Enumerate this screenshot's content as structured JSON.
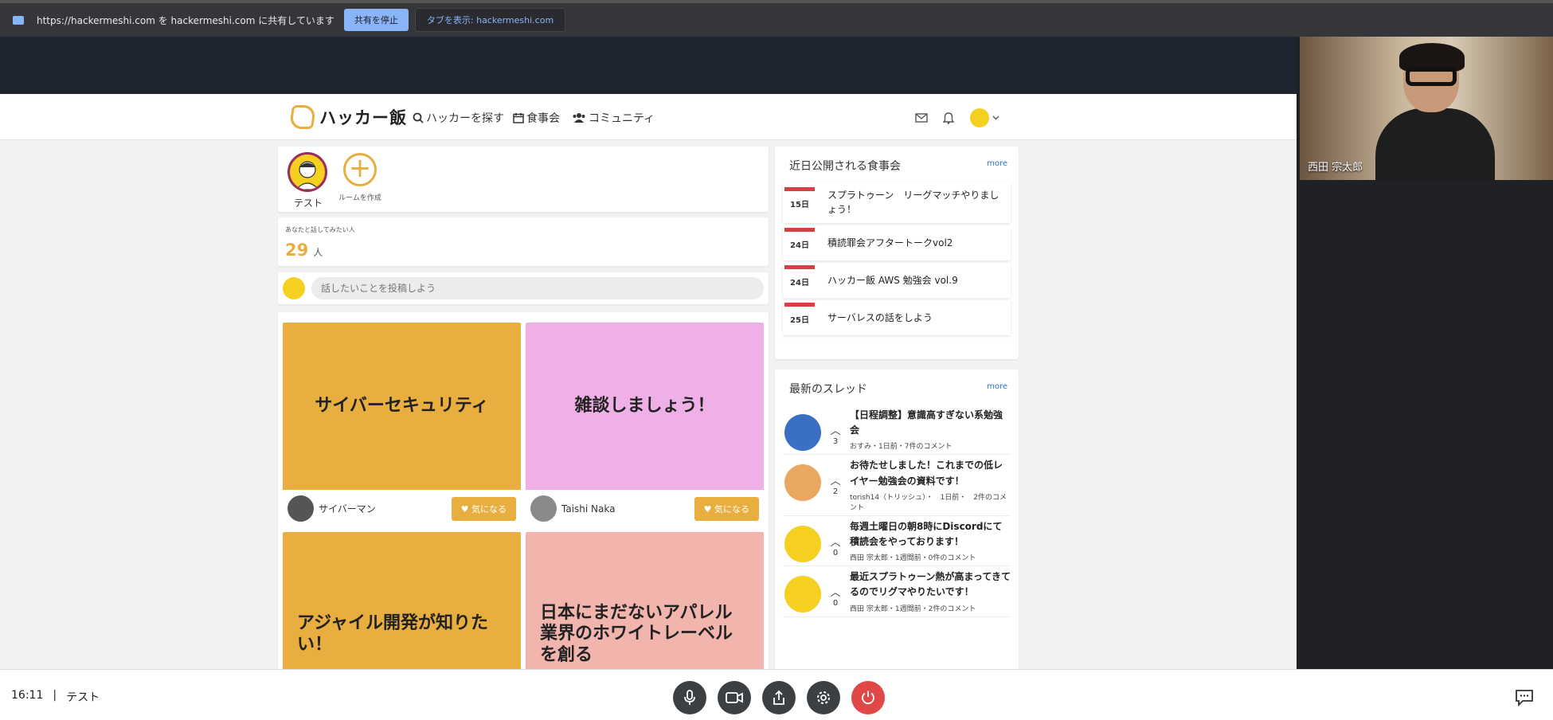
{
  "share_bar": {
    "message": "https://hackermeshi.com を hackermeshi.com に共有しています",
    "stop_label": "共有を停止",
    "show_tab_label": "タブを表示: hackermeshi.com"
  },
  "site": {
    "logo_text": "ハッカー飯",
    "nav": [
      "ハッカーを探す",
      "食事会",
      "コミュニティ"
    ]
  },
  "stories": {
    "user_name": "テスト",
    "create_label": "ルームを作成"
  },
  "want_to_talk": {
    "label": "あなたと話してみたい人",
    "count": "29",
    "unit": "人"
  },
  "post": {
    "placeholder": "話したいことを投稿しよう"
  },
  "rooms": [
    {
      "title": "サイバーセキュリティ",
      "owner": "サイバーマン",
      "like_label": "気になる",
      "color": "#e8ae3f"
    },
    {
      "title": "雑談しましょう！",
      "owner": "Taishi Naka",
      "like_label": "気になる",
      "color": "#eeb0e6"
    },
    {
      "title": "アジャイル開発が知りたい！",
      "color": "#e8ae3f"
    },
    {
      "title": "日本にまだないアパレル業界のホワイトレーベルを創る",
      "color": "#f1b5ad"
    }
  ],
  "events": {
    "title": "近日公開される食事会",
    "more": "more",
    "items": [
      {
        "date": "15日",
        "title": "スプラトゥーン　リーグマッチやりましょう！"
      },
      {
        "date": "24日",
        "title": "積読罪会アフタートークvol2"
      },
      {
        "date": "24日",
        "title": "ハッカー飯 AWS 勉強会 vol.9"
      },
      {
        "date": "25日",
        "title": "サーバレスの話をしよう"
      }
    ]
  },
  "threads": {
    "title": "最新のスレッド",
    "more": "more",
    "items": [
      {
        "votes": "3",
        "title": "【日程調整】意識高すぎない系勉強会",
        "meta": "おすみ・1日前・7件のコメント",
        "avatar_color": "#3a6fc4"
      },
      {
        "votes": "2",
        "title": "お待たせしました！これまでの低レイヤー勉強会の資料です！",
        "meta": "torish14（トリッシュ）・　1日前・　2件のコメント",
        "avatar_color": "#e9a860"
      },
      {
        "votes": "0",
        "title": "毎週土曜日の朝8時にDiscordにて積読会をやっております！",
        "meta": "西田 宗太郎・1週間前・0件のコメント",
        "avatar_color": "#f5d020"
      },
      {
        "votes": "0",
        "title": "最近スプラトゥーン熱が高まってきてるのでリグマやりたいです！",
        "meta": "西田 宗太郎・1週間前・2件のコメント",
        "avatar_color": "#f5d020"
      }
    ]
  },
  "camera": {
    "participant_name": "西田 宗太郎"
  },
  "meeting": {
    "time": "16:11",
    "separator": "|",
    "name": "テスト"
  }
}
